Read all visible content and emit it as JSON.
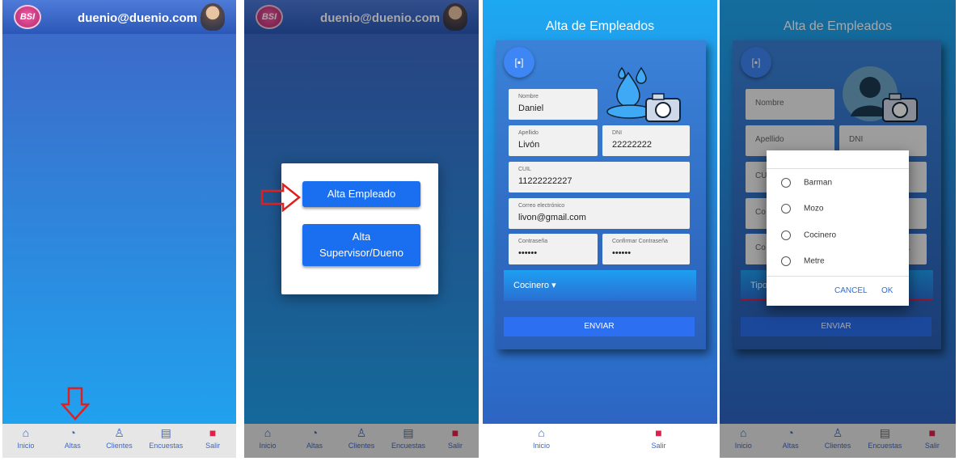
{
  "screen1": {
    "email": "duenio@duenio.com",
    "logo": "BSI"
  },
  "screen2": {
    "email": "duenio@duenio.com",
    "logo": "BSI",
    "alta_empleado": "Alta Empleado",
    "alta_supervisor_1": "Alta",
    "alta_supervisor_2": "Supervisor/Dueno"
  },
  "tabs": [
    {
      "label": "Inicio",
      "icon": "home-icon"
    },
    {
      "label": "Altas",
      "icon": "gauge-icon"
    },
    {
      "label": "Clientes",
      "icon": "person-icon"
    },
    {
      "label": "Encuestas",
      "icon": "money-icon"
    },
    {
      "label": "Salir",
      "icon": "logout-icon"
    }
  ],
  "screen3": {
    "title": "Alta de Empleados",
    "form": {
      "nombre": {
        "label": "Nombre",
        "value": "Daniel"
      },
      "apellido": {
        "label": "Apellido",
        "value": "Livón"
      },
      "dni": {
        "label": "DNI",
        "value": "22222222"
      },
      "cuil": {
        "label": "CUIL",
        "value": "11222222227"
      },
      "correo": {
        "label": "Correo electrónico",
        "value": "livon@gmail.com"
      },
      "contrasena": {
        "label": "Contraseña",
        "value": "••••••"
      },
      "confirmar": {
        "label": "Confirmar Contraseña",
        "value": "••••••"
      }
    },
    "tipo": "Cocinero",
    "send": "ENVIAR",
    "bottom": [
      {
        "label": "Inicio",
        "icon": "home-icon"
      },
      {
        "label": "Salir",
        "icon": "logout-icon"
      }
    ]
  },
  "screen4": {
    "title": "Alta de Empleados",
    "ph": {
      "nombre": "Nombre",
      "apellido": "Apellido",
      "dni": "DNI",
      "cuil": "CU",
      "correo": "Co",
      "pass": "Co",
      "pass2": "..."
    },
    "tipo": "Tipo",
    "send": "ENVIAR",
    "options": [
      "Barman",
      "Mozo",
      "Cocinero",
      "Metre"
    ],
    "cancel": "CANCEL",
    "ok": "OK"
  }
}
